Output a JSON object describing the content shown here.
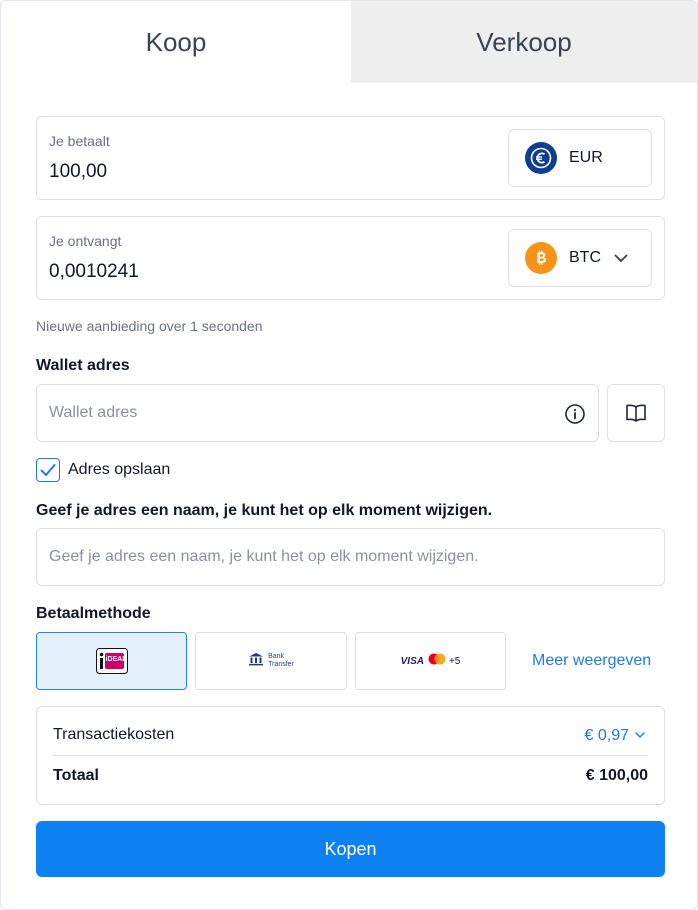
{
  "tabs": {
    "buy": "Koop",
    "sell": "Verkoop"
  },
  "pay_field": {
    "label": "Je betaalt",
    "value": "100,00",
    "currency": "EUR",
    "currency_icon": "euro-coin-icon"
  },
  "receive_field": {
    "label": "Je ontvangt",
    "value": "0,0010241",
    "currency": "BTC",
    "currency_icon": "bitcoin-coin-icon"
  },
  "offer_notice": "Nieuwe aanbieding over 1 seconden",
  "wallet": {
    "label": "Wallet adres",
    "placeholder": "Wallet adres"
  },
  "save_address": {
    "label": "Adres opslaan",
    "checked": true
  },
  "address_name": {
    "label": "Geef je adres een naam, je kunt het op elk moment wijzigen.",
    "placeholder": "Geef je adres een naam, je kunt het op elk moment wijzigen."
  },
  "payment": {
    "label": "Betaalmethode",
    "methods": [
      {
        "name": "iDEAL",
        "text": "iDEAL",
        "selected": true
      },
      {
        "name": "Bank Transfer",
        "line1": "Bank",
        "line2": "Transfer",
        "selected": false
      },
      {
        "name": "Cards",
        "visa": "VISA",
        "more": "+5",
        "selected": false
      }
    ],
    "more_link": "Meer weergeven"
  },
  "summary": {
    "fee_label": "Transactiekosten",
    "fee_value": "€ 0,97",
    "total_label": "Totaal",
    "total_value": "€ 100,00"
  },
  "submit": "Kopen",
  "colors": {
    "accent": "#0d80f2",
    "euro": "#0f3d91",
    "bitcoin": "#f7931a",
    "selected_bg": "#e4f0fc"
  }
}
